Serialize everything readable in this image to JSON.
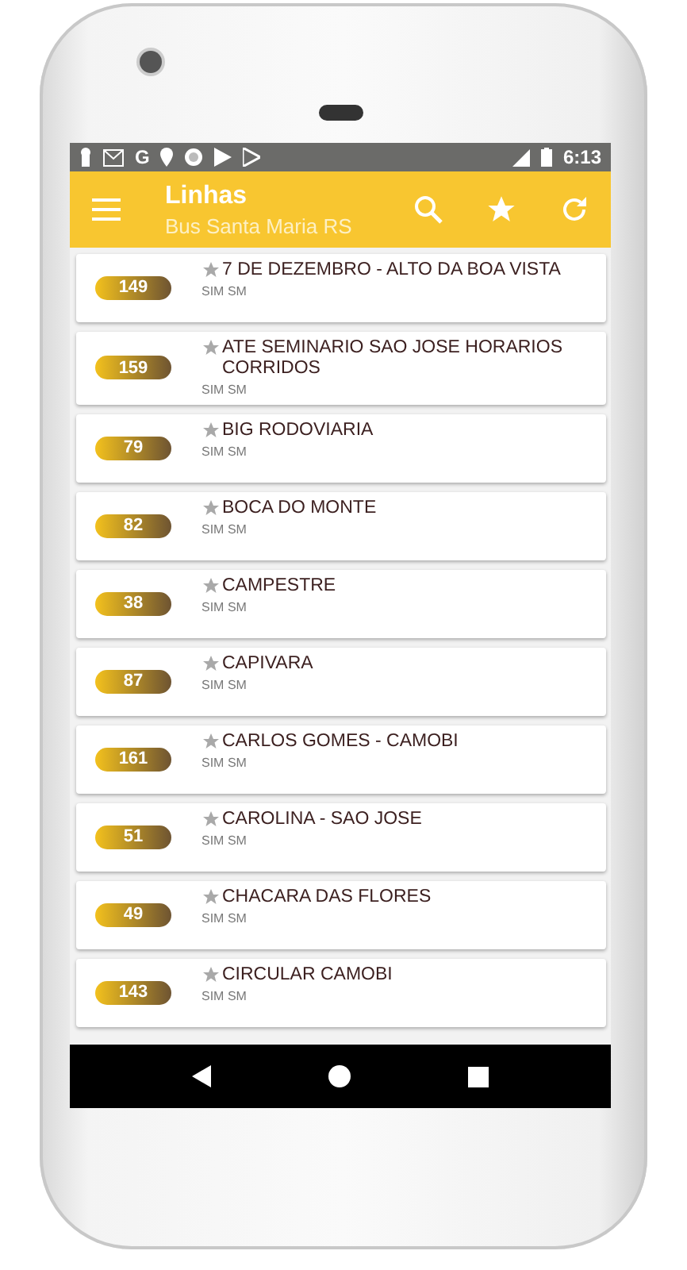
{
  "status_bar": {
    "app_letter": "G",
    "time": "6:13"
  },
  "app_bar": {
    "title": "Linhas",
    "subtitle": "Bus Santa Maria RS"
  },
  "lines": [
    {
      "number": "149",
      "name": "7 DE DEZEMBRO - ALTO DA BOA VISTA",
      "company": "SIM SM",
      "favorite": false
    },
    {
      "number": "159",
      "name": "ATE SEMINARIO SAO JOSE HORARIOS CORRIDOS",
      "company": "SIM SM",
      "favorite": false
    },
    {
      "number": "79",
      "name": "BIG RODOVIARIA",
      "company": "SIM SM",
      "favorite": false
    },
    {
      "number": "82",
      "name": "BOCA DO MONTE",
      "company": "SIM SM",
      "favorite": false
    },
    {
      "number": "38",
      "name": "CAMPESTRE",
      "company": "SIM SM",
      "favorite": false
    },
    {
      "number": "87",
      "name": "CAPIVARA",
      "company": "SIM SM",
      "favorite": false
    },
    {
      "number": "161",
      "name": "CARLOS GOMES - CAMOBI",
      "company": "SIM SM",
      "favorite": false
    },
    {
      "number": "51",
      "name": "CAROLINA - SAO JOSE",
      "company": "SIM SM",
      "favorite": false
    },
    {
      "number": "49",
      "name": "CHACARA DAS FLORES",
      "company": "SIM SM",
      "favorite": false
    },
    {
      "number": "143",
      "name": "CIRCULAR CAMOBI",
      "company": "SIM SM",
      "favorite": false
    }
  ]
}
